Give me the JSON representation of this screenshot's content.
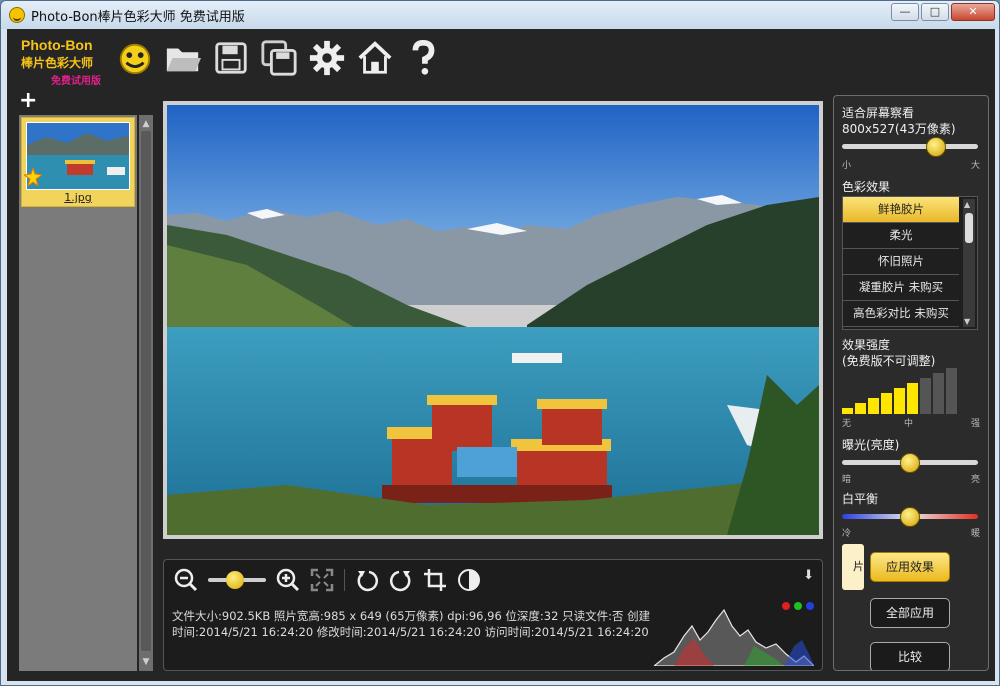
{
  "window": {
    "title": "Photo-Bon棒片色彩大师 免费试用版",
    "btn_min": "—",
    "btn_max": "□",
    "btn_close": "✕"
  },
  "brand": {
    "line1": "Photo-Bon",
    "line2": "棒片色彩大师",
    "line3": "免费试用版"
  },
  "toolbar": [
    {
      "name": "smiley-icon"
    },
    {
      "name": "open-folder-icon"
    },
    {
      "name": "save-icon"
    },
    {
      "name": "save-as-icon"
    },
    {
      "name": "settings-gear-icon"
    },
    {
      "name": "home-icon"
    },
    {
      "name": "help-icon"
    }
  ],
  "thumbnails": {
    "add_label": "+",
    "items": [
      {
        "filename": "1.jpg"
      }
    ]
  },
  "info": {
    "download_label": "⬇",
    "text": "文件大小:902.5KB    照片宽高:985 x 649 (65万像素)    dpi:96,96    位深度:32    只读文件:否    创建时间:2014/5/21 16:24:20    修改时间:2014/5/21 16:24:20    访问时间:2014/5/21 16:24:20"
  },
  "right_panel": {
    "fit_label": "适合屏幕察看",
    "size_label": "800x527(43万像素)",
    "size_min": "小",
    "size_max": "大",
    "size_value": 0.72,
    "effects_title": "色彩效果",
    "effects": [
      "鲜艳胶片",
      "柔光",
      "怀旧照片",
      "凝重胶片 未购买",
      "高色彩对比 未购买"
    ],
    "selected_effect": 0,
    "strength_title": "效果强度",
    "strength_note": "(免费版不可调整)",
    "strength_min": "无",
    "strength_mid": "中",
    "strength_max": "强",
    "strength_level": 6,
    "strength_total": 9,
    "exposure_title": "曝光(亮度)",
    "exposure_min": "暗",
    "exposure_max": "亮",
    "exposure_value": 0.5,
    "wb_title": "白平衡",
    "wb_min": "冷",
    "wb_max": "暖",
    "wb_value": 0.5,
    "side_button": "片",
    "apply_label": "应用效果",
    "apply_all_label": "全部应用",
    "compare_label": "比较"
  },
  "colors": {
    "accent": "#f5c31b",
    "panel": "#252525",
    "selected": "#f2d45c"
  }
}
